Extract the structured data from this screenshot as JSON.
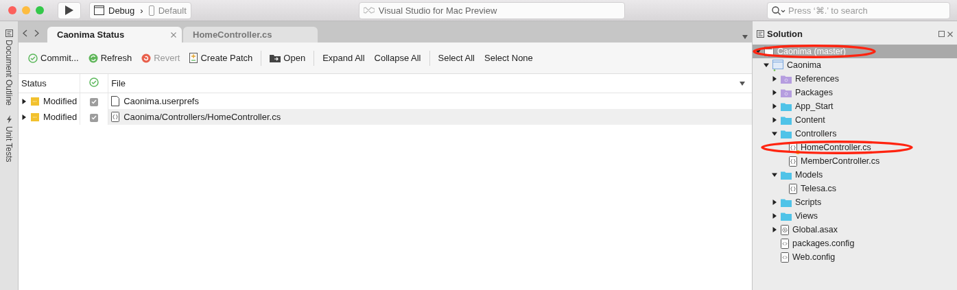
{
  "window": {
    "configuration": "Debug",
    "separator": "›",
    "device": "Default",
    "title": "Visual Studio for Mac Preview",
    "search": {
      "placeholder": "Press ‘⌘.’ to search"
    }
  },
  "side_pads": [
    {
      "label": "Document Outline"
    },
    {
      "label": "Unit Tests"
    }
  ],
  "tabs": [
    {
      "label": "Caonima Status",
      "selected": true,
      "closable": true
    },
    {
      "label": "HomeController.cs",
      "selected": false,
      "closable": false
    }
  ],
  "toolbar": [
    [
      {
        "label": "Commit...",
        "disabled": false
      },
      {
        "label": "Refresh",
        "disabled": false
      },
      {
        "label": "Revert",
        "disabled": true
      },
      {
        "label": "Create Patch",
        "disabled": false
      }
    ],
    [
      {
        "label": "Open",
        "disabled": false
      }
    ],
    [
      {
        "label": "Expand All",
        "disabled": false
      },
      {
        "label": "Collapse All",
        "disabled": false
      }
    ],
    [
      {
        "label": "Select All",
        "disabled": false
      },
      {
        "label": "Select None",
        "disabled": false
      }
    ]
  ],
  "table": {
    "columns": [
      {
        "kind": "text",
        "label": "Status"
      },
      {
        "kind": "icon"
      },
      {
        "kind": "text",
        "label": "File"
      }
    ],
    "rows": [
      {
        "expanded": false,
        "status": "Modified",
        "checked": true,
        "kind": "file",
        "file": "Caonima.userprefs"
      },
      {
        "expanded": false,
        "status": "Modified",
        "checked": true,
        "kind": "code-file",
        "file": "Caonima/Controllers/HomeController.cs"
      }
    ]
  },
  "solution": {
    "title": "Solution",
    "tree": [
      {
        "label": "Caonima (master)",
        "kind": "solution",
        "expanded": true,
        "selected": true,
        "circled": true,
        "children": [
          {
            "label": "Caonima",
            "kind": "project",
            "expanded": true,
            "selected": false,
            "children": [
              {
                "label": "References",
                "kind": "special-folder",
                "expanded": false,
                "selected": false
              },
              {
                "label": "Packages",
                "kind": "special-folder",
                "expanded": false,
                "selected": false
              },
              {
                "label": "App_Start",
                "kind": "folder",
                "expanded": false,
                "selected": false
              },
              {
                "label": "Content",
                "kind": "folder",
                "expanded": false,
                "selected": false
              },
              {
                "label": "Controllers",
                "kind": "folder",
                "expanded": true,
                "selected": false,
                "children": [
                  {
                    "label": "HomeController.cs",
                    "kind": "code-file",
                    "selected": false,
                    "circled": true,
                    "modified": true
                  },
                  {
                    "label": "MemberController.cs",
                    "kind": "code-file",
                    "selected": false
                  }
                ]
              },
              {
                "label": "Models",
                "kind": "folder",
                "expanded": true,
                "selected": false,
                "children": [
                  {
                    "label": "Telesa.cs",
                    "kind": "code-file",
                    "selected": false
                  }
                ]
              },
              {
                "label": "Scripts",
                "kind": "folder",
                "expanded": false,
                "selected": false
              },
              {
                "label": "Views",
                "kind": "folder",
                "expanded": false,
                "selected": false
              },
              {
                "label": "Global.asax",
                "kind": "asax-file",
                "expanded": false,
                "selected": false
              },
              {
                "label": "packages.config",
                "kind": "config-file",
                "selected": false
              },
              {
                "label": "Web.config",
                "kind": "config-file",
                "selected": false
              }
            ]
          }
        ]
      }
    ]
  }
}
